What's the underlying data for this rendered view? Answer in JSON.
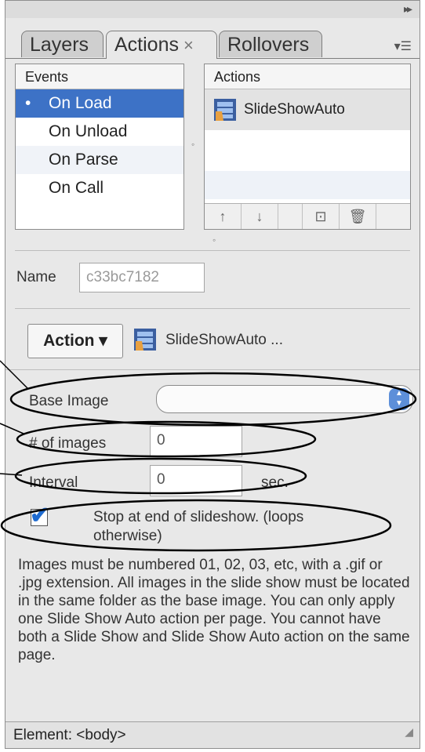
{
  "panel": {
    "tabs": [
      {
        "label": "Layers",
        "close": ""
      },
      {
        "label": "Actions",
        "close": "×"
      },
      {
        "label": "Rollovers",
        "close": ""
      }
    ],
    "collapse_glyph": "▸▸",
    "menu_glyph": "▾☰"
  },
  "events": {
    "header": "Events",
    "items": [
      "On Load",
      "On Unload",
      "On Parse",
      "On Call"
    ]
  },
  "actions": {
    "header": "Actions",
    "items": [
      "SlideShowAuto"
    ],
    "toolbar": [
      "↑",
      "↓",
      "⊡",
      "🗑"
    ]
  },
  "name": {
    "label": "Name",
    "value": "c33bc7182"
  },
  "action_section": {
    "button_label": "Action ▾",
    "current": "SlideShowAuto ..."
  },
  "form": {
    "base_image": {
      "label": "Base Image",
      "value": ""
    },
    "num_images": {
      "label": "# of images",
      "value": "0"
    },
    "interval": {
      "label": "Interval",
      "value": "0",
      "unit": "sec."
    },
    "stop_checkbox": {
      "line1": "Stop at end of slideshow. (loops",
      "line2": "otherwise)",
      "checked": true
    }
  },
  "description": "Images must be numbered 01, 02, 03, etc, with a .gif or .jpg extension. All images in the slide show must be located in the same folder as the base image. You can only apply one Slide Show Auto action per page. You cannot have both a Slide Show and Slide Show Auto action on the same page.",
  "status": {
    "text": "Element: <body>"
  }
}
